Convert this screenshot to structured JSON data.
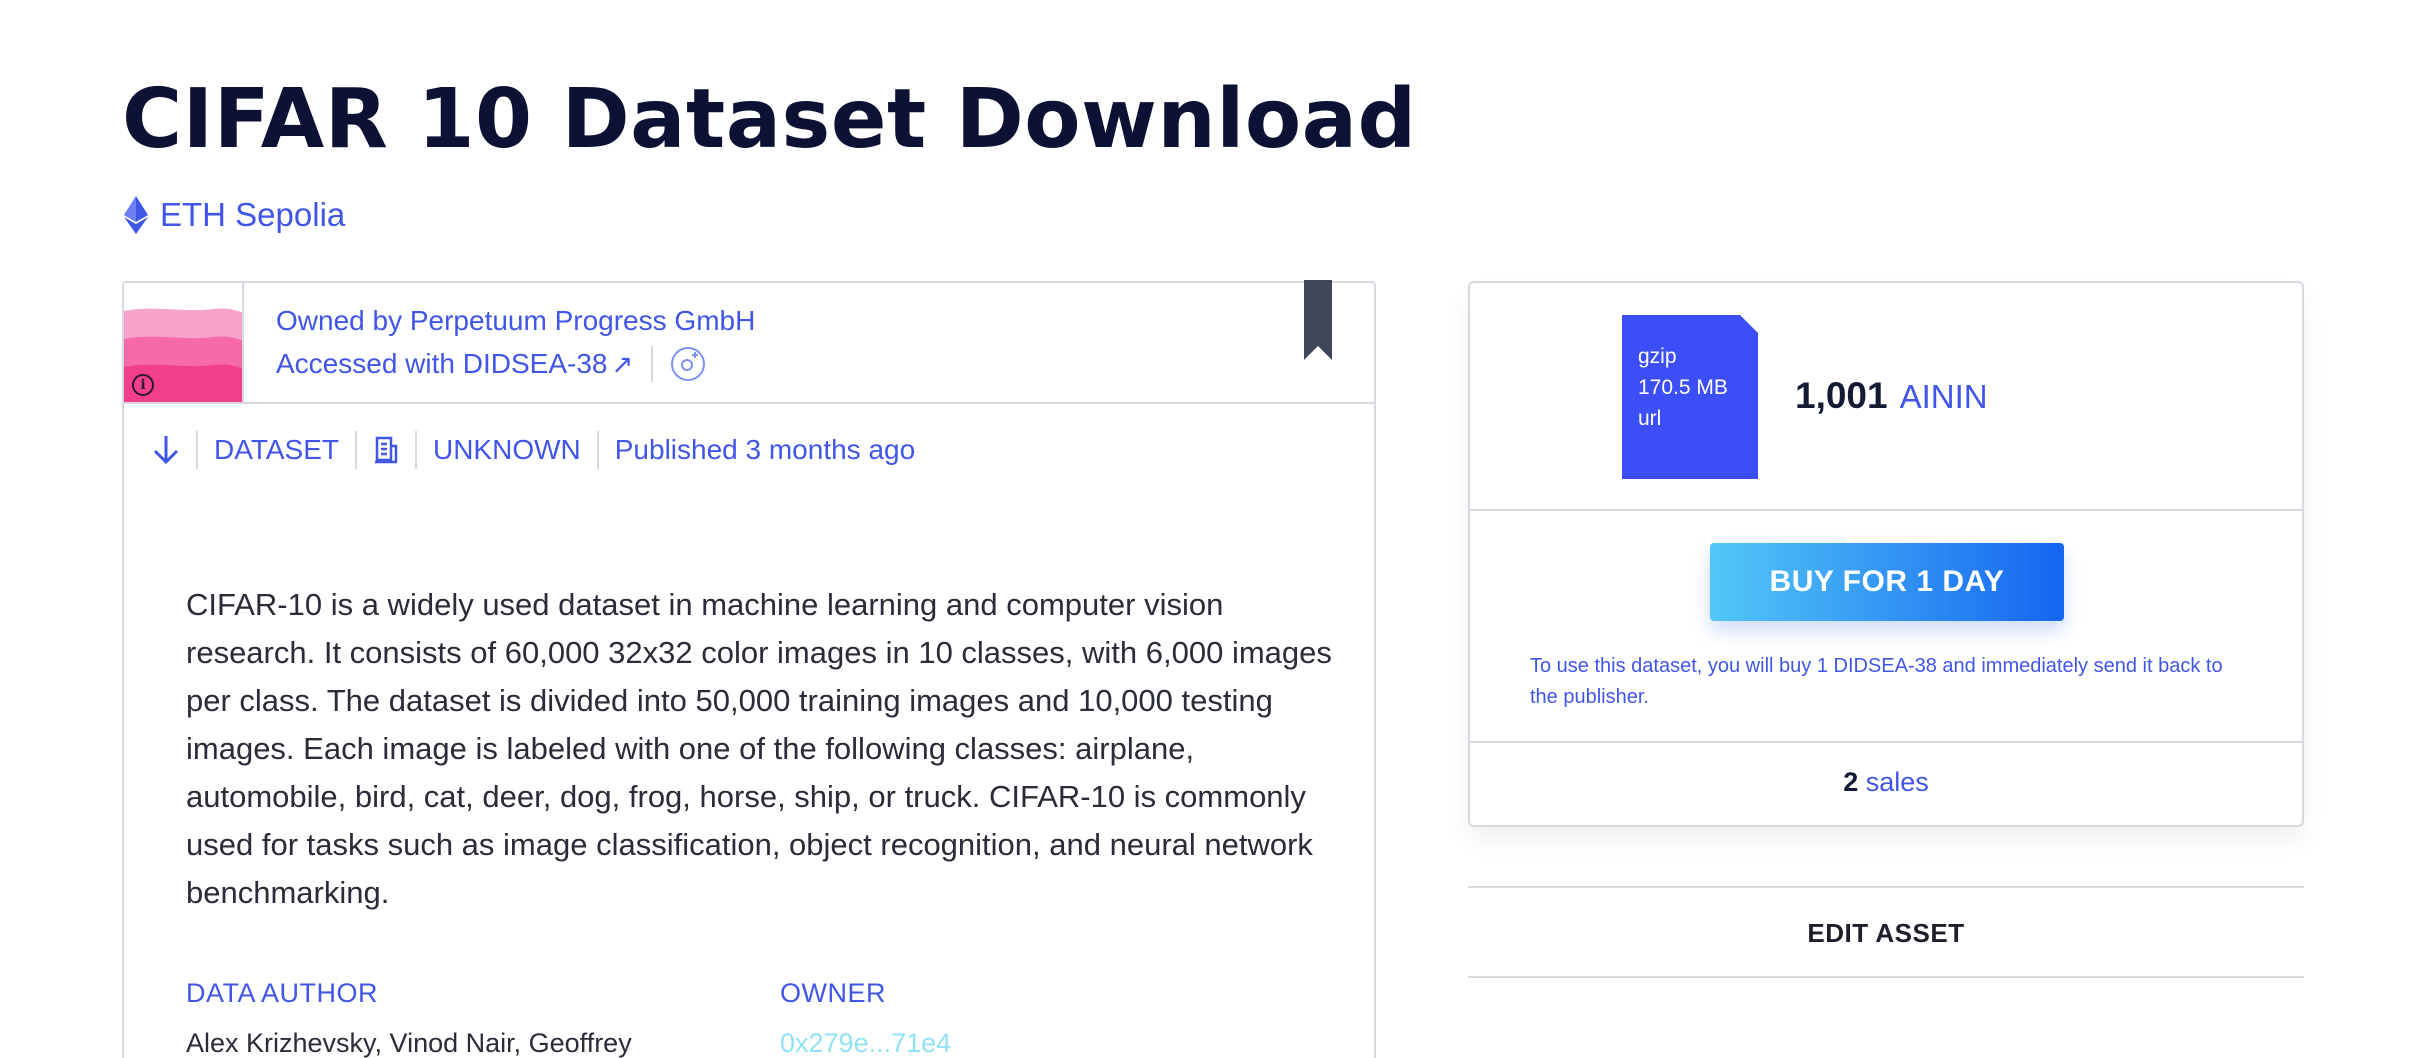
{
  "page": {
    "title": "CIFAR 10 Dataset Download",
    "network": "ETH Sepolia"
  },
  "asset": {
    "owned_by": "Owned by Perpetuum Progress GmbH",
    "accessed_with": "Accessed with DIDSEA-38",
    "accessed_arrow": "↗",
    "meta": {
      "type": "DATASET",
      "license": "UNKNOWN",
      "published": "Published 3 months ago"
    },
    "description": "CIFAR-10 is a widely used dataset in machine learning and computer vision research. It consists of 60,000 32x32 color images in 10 classes, with 6,000 images per class. The dataset is divided into 50,000 training images and 10,000 testing images. Each image is labeled with one of the following classes: airplane, automobile, bird, cat, deer, dog, frog, horse, ship, or truck. CIFAR-10 is commonly used for tasks such as image classification, object recognition, and neural network benchmarking.",
    "data_author_label": "DATA AUTHOR",
    "data_author_value": "Alex Krizhevsky, Vinod Nair, Geoffrey",
    "owner_label": "OWNER",
    "owner_value": "0x279e...71e4"
  },
  "purchase": {
    "file": {
      "type": "gzip",
      "size": "170.5 MB",
      "source": "url"
    },
    "price_amount": "1,001",
    "price_currency": "AININ",
    "buy_label": "BUY FOR 1 DAY",
    "note": "To use this dataset, you will buy 1 DIDSEA-38 and immediately send it back to the publisher.",
    "sales_count": "2",
    "sales_label": "sales"
  },
  "actions": {
    "edit_label": "EDIT ASSET"
  },
  "colors": {
    "accent": "#4156e6",
    "title": "#0d1133",
    "file_icon": "#3c4ef5",
    "button_start": "#52c7f7",
    "button_end": "#1565f0",
    "owner_hash": "#8fe3f5"
  },
  "icons": [
    "ethereum-icon",
    "info-icon",
    "external-link-icon",
    "profile-link-icon",
    "bookmark-icon",
    "download-icon",
    "license-icon"
  ]
}
